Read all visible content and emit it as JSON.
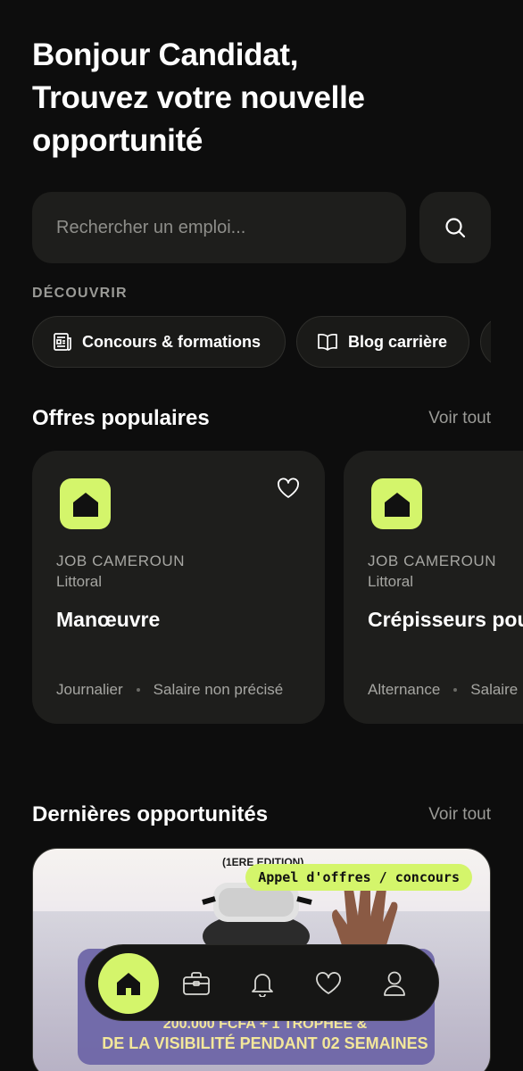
{
  "header": {
    "greeting_line1": "Bonjour Candidat,",
    "greeting_line2": "Trouvez votre nouvelle",
    "greeting_line3": "opportunité"
  },
  "search": {
    "placeholder": "Rechercher un emploi...",
    "button_icon": "search-icon"
  },
  "discover": {
    "label": "DÉCOUVRIR",
    "chips": [
      {
        "label": "Concours & formations",
        "icon": "newspaper-icon"
      },
      {
        "label": "Blog carrière",
        "icon": "book-icon"
      }
    ]
  },
  "popular": {
    "title": "Offres populaires",
    "see_all": "Voir tout",
    "jobs": [
      {
        "company": "JOB CAMEROUN",
        "location": "Littoral",
        "title": "Manœuvre",
        "contract": "Journalier",
        "salary": "Salaire non précisé"
      },
      {
        "company": "JOB CAMEROUN",
        "location": "Littoral",
        "title": "Crépisseurs pour chantier",
        "contract": "Alternance",
        "salary": "Salaire non précisé"
      }
    ]
  },
  "latest": {
    "title": "Dernières opportunités",
    "see_all": "Voir tout",
    "card": {
      "badge": "Appel d'offres / concours",
      "edition": "(1ERE EDITION)",
      "line1": "200.000 FCFA + 1 TROPHÉE &",
      "line2": "DE LA VISIBILITÉ PENDANT 02 SEMAINES"
    }
  },
  "nav": {
    "items": [
      "home-icon",
      "briefcase-icon",
      "bell-icon",
      "heart-icon",
      "user-icon"
    ]
  },
  "colors": {
    "background": "#0d0d0d",
    "card": "#1e1e1c",
    "accent": "#d4f56b",
    "muted_text": "#a6a6a2"
  }
}
